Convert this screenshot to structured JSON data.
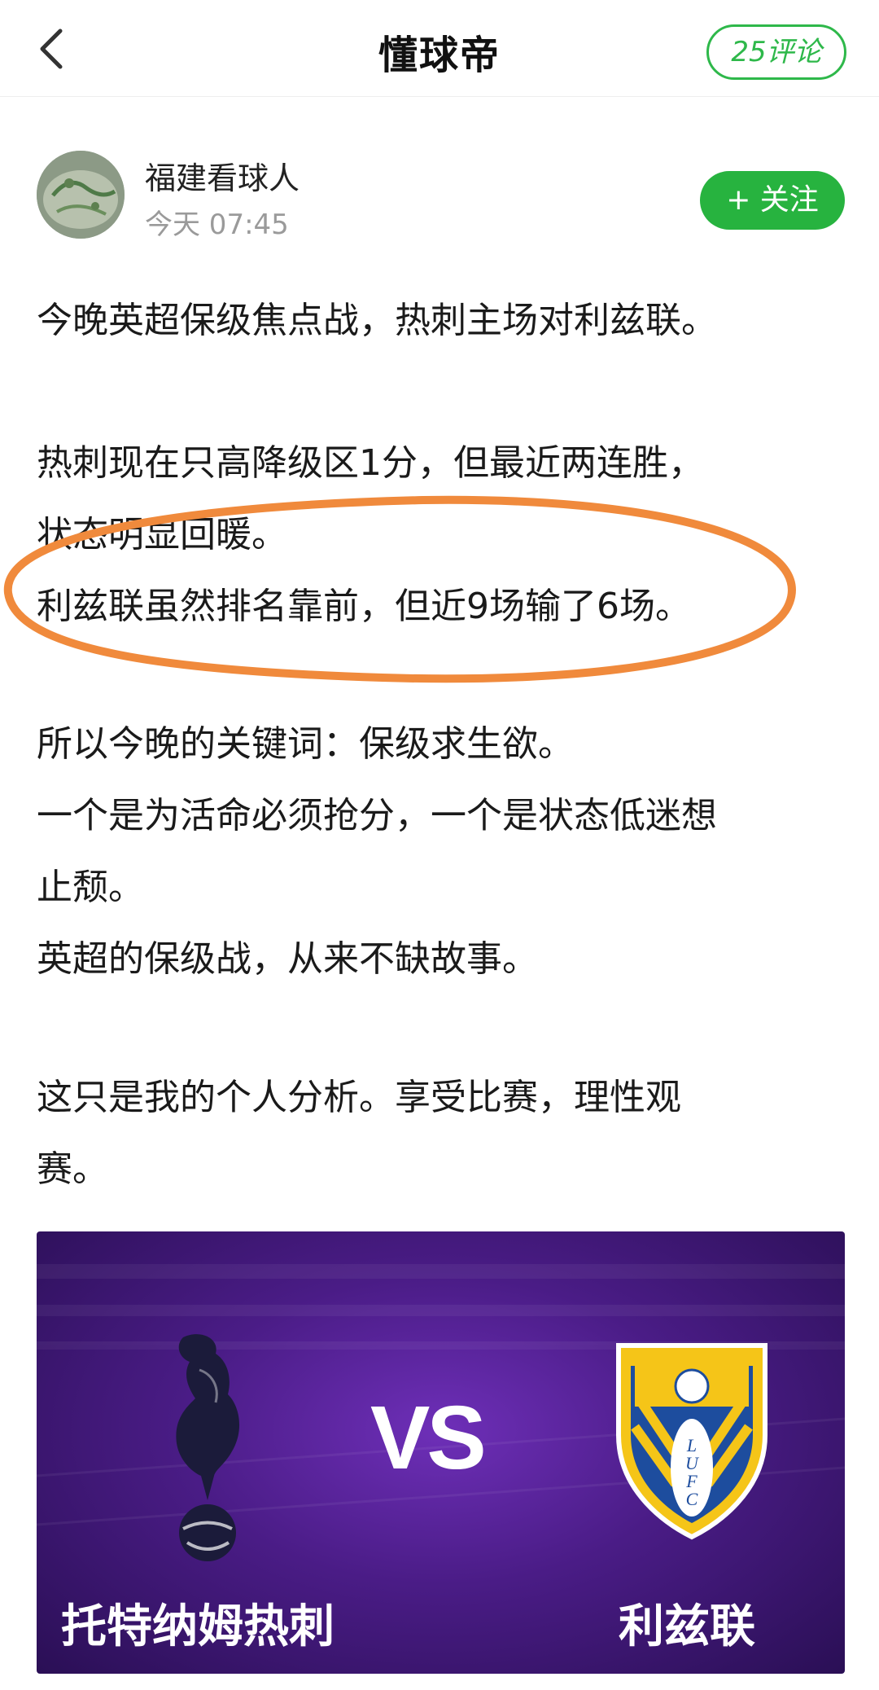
{
  "header": {
    "back_icon": "chevron-left-icon",
    "title": "懂球帝",
    "comments_label": "25评论"
  },
  "author": {
    "name": "福建看球人",
    "time": "今天 07:45",
    "follow_label": "+ 关注"
  },
  "post": {
    "p1": "今晚英超保级焦点战，热刺主场对利兹联。",
    "p2a": "热刺现在只高降级区1分，但最近两连胜，",
    "p2b": "状态明显回暖。",
    "p3": "利兹联虽然排名靠前，但近9场输了6场。",
    "p4": "所以今晚的关键词：保级求生欲。",
    "p5a": "一个是为活命必须抢分，一个是状态低迷想",
    "p5b": "止颓。",
    "p6": "英超的保级战，从来不缺故事。",
    "p7a": "这只是我的个人分析。享受比赛，理性观",
    "p7b": "赛。"
  },
  "match_card": {
    "home_team": "托特纳姆热刺",
    "vs_label": "VS",
    "away_team": "利兹联",
    "home_logo": "tottenham-crest-icon",
    "away_logo": "leeds-crest-icon",
    "away_crest_text": "LUFC"
  },
  "colors": {
    "brand_green": "#27b33f",
    "annotation_orange": "#f08a3c",
    "card_purple": "#4a1c86"
  }
}
